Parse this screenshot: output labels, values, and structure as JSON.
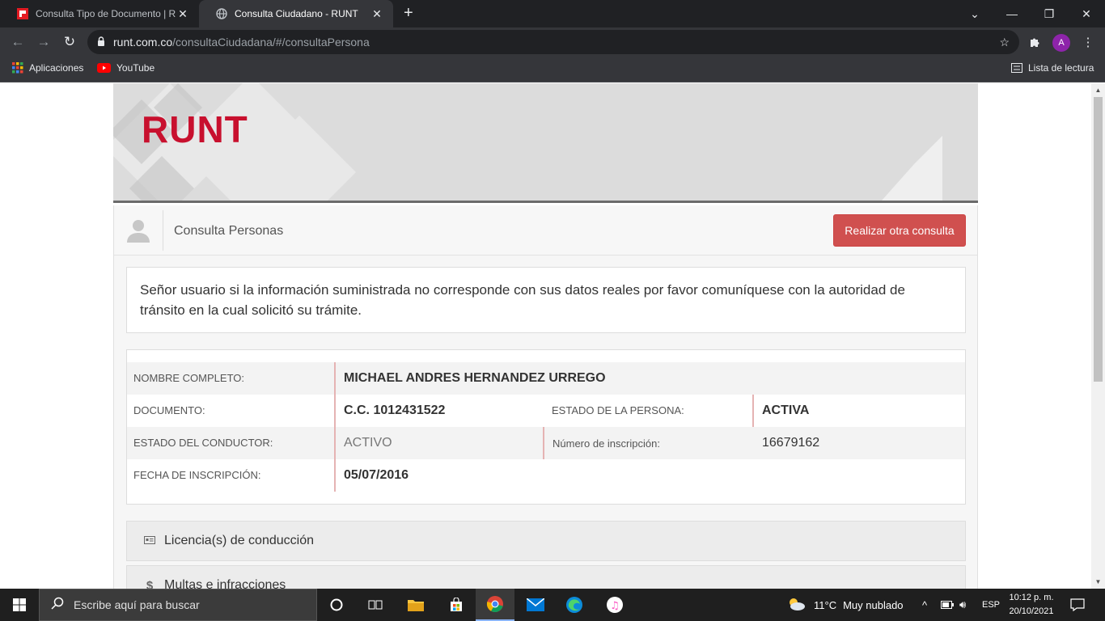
{
  "browser": {
    "tabs": [
      {
        "title": "Consulta Tipo de Documento | RUNT",
        "active": false
      },
      {
        "title": "Consulta Ciudadano - RUNT",
        "active": true
      }
    ],
    "url_host": "runt.com.co",
    "url_path": "/consultaCiudadana/#/consultaPersona",
    "profile_initial": "A",
    "bookmarks": [
      {
        "label": "Aplicaciones",
        "icon": "apps-grid-icon"
      },
      {
        "label": "YouTube",
        "icon": "youtube-icon"
      }
    ],
    "reading_list": "Lista de lectura"
  },
  "page": {
    "logo_text": "RUNT",
    "panel_title": "Consulta Personas",
    "other_query_button": "Realizar otra consulta",
    "notice": "Señor usuario si la información suministrada no corresponde con sus datos reales por favor comuníquese con la autoridad de tránsito en la cual solicitó su trámite.",
    "person": {
      "nombre_label": "NOMBRE COMPLETO:",
      "nombre_value": "MICHAEL ANDRES HERNANDEZ URREGO",
      "documento_label": "DOCUMENTO:",
      "documento_value": "C.C. 1012431522",
      "estado_persona_label": "ESTADO DE LA PERSONA:",
      "estado_persona_value": "ACTIVA",
      "estado_conductor_label": "ESTADO DEL CONDUCTOR:",
      "estado_conductor_value": "ACTIVO",
      "inscripcion_num_label": "Número de inscripción:",
      "inscripcion_num_value": "16679162",
      "fecha_label": "FECHA DE INSCRIPCIÓN:",
      "fecha_value": "05/07/2016"
    },
    "sections": [
      {
        "label": "Licencia(s) de conducción",
        "icon": "license-card-icon"
      },
      {
        "label": "Multas e infracciones",
        "icon": "dollar-icon"
      }
    ]
  },
  "taskbar": {
    "search_placeholder": "Escribe aquí para buscar",
    "weather_temp": "11°C",
    "weather_desc": "Muy nublado",
    "language": "ESP",
    "time": "10:12 p. m.",
    "date": "20/10/2021"
  },
  "colors": {
    "brand_red": "#c8102e",
    "button_red": "#d0504f",
    "chrome_dark": "#202124"
  }
}
